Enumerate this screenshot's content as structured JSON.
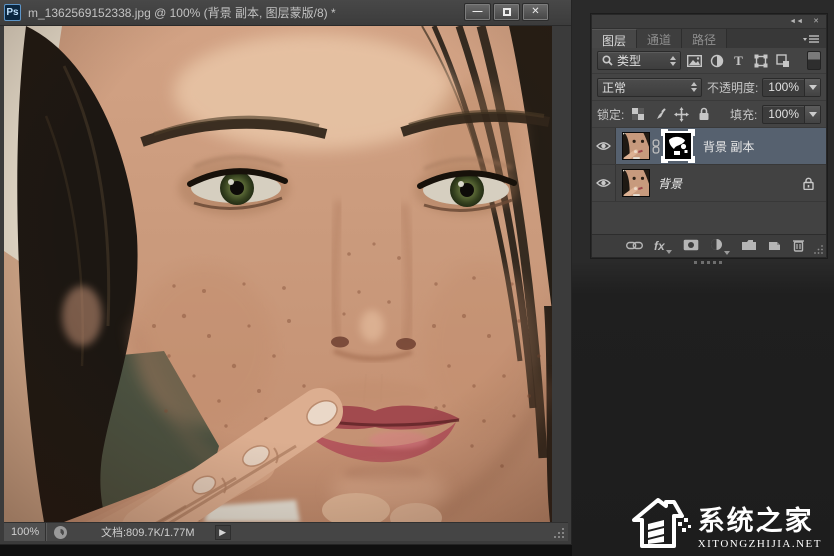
{
  "window": {
    "icon_label": "Ps",
    "title": "m_1362569152338.jpg @ 100% (背景 副本, 图层蒙版/8) *",
    "minimize_glyph": "—",
    "close_glyph": "✕"
  },
  "statusbar": {
    "zoom": "100%",
    "doc_info": "文档:809.7K/1.77M"
  },
  "panel": {
    "collapse_glyph": "◄◄",
    "close_glyph": "✕",
    "tabs": [
      {
        "label": "图层"
      },
      {
        "label": "通道"
      },
      {
        "label": "路径"
      }
    ],
    "filter_type_label": "类型",
    "blend_mode": "正常",
    "opacity_label": "不透明度:",
    "opacity_value": "100%",
    "lock_label": "锁定:",
    "fill_label": "填充:",
    "fill_value": "100%",
    "fx_label": "fx",
    "layers": [
      {
        "name": "背景 副本"
      },
      {
        "name": "背景"
      }
    ]
  },
  "watermark": {
    "title": "系统之家",
    "domain": "XITONGZHIJIA.NET"
  },
  "colors": {
    "selected_layer": "#56616f",
    "panel_bg": "#444444",
    "app_bg": "#2a2a2a",
    "titlebar_bg": "#424242"
  }
}
